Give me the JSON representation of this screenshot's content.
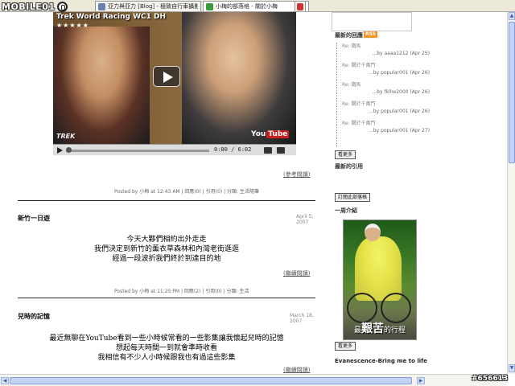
{
  "brand": {
    "wordmark": "MOBILE01",
    "icon": "mobile01-logo-icon"
  },
  "tabs": [
    {
      "label": "亞力與亞力 [Blog] - 極致自行車攝影部落格",
      "favicon_color": "#6b7fb3",
      "close": "x"
    },
    {
      "label": "小梅的部落格 - 關於小梅",
      "favicon_color": "#3a9a3a",
      "close": "x"
    },
    {
      "label": "",
      "favicon_color": "#cc3333",
      "close": ""
    }
  ],
  "video": {
    "title": "Trek World Racing WC1 DH",
    "stars": "★★★★★",
    "brand_trek": "TREK",
    "brand_you": "You",
    "brand_tube": "Tube",
    "time": "0:00 / 6:02",
    "progress": 0.0
  },
  "post1": {
    "more": "(參考閱讀)",
    "meta": "Posted by 小梅 at 12:43 AM | 回應(0) | 引用(0) | 分類: 生活隨筆"
  },
  "post2": {
    "title": "新竹一日遊",
    "date": "April 5, 2007",
    "lines": [
      "今天大夥們相約出外走走",
      "我們決定到新竹的薰衣草森林和內灣老街逛逛",
      "經過一段波折我們終於到達目的地"
    ],
    "more": "(繼續閱讀)",
    "meta": "Posted by 小梅 at 11:25 PM | 回應(2) | 引用(0) | 分類: 生活"
  },
  "post3": {
    "title": "兒時的記憶",
    "date": "March 18, 2007",
    "lines": [
      "最近無聊在YouTube看到一些小時候常看的一些影集讓我懷起兒時的記憶",
      "想起每天時間一到就會準時收看",
      "我相信有不少人小時候跟我也有過這些影集"
    ],
    "more": "(繼續閱讀)"
  },
  "sidebar": {
    "trackback_title": "最新的回應",
    "rss": "RSS",
    "trackbacks": [
      {
        "head": "Re: 鐵馬",
        "by": "...by aaaa1212 (Apr 25)"
      },
      {
        "head": "Re: 關於千萬門",
        "by": "...by popular001 (Apr 26)"
      },
      {
        "head": "Re: 鐵馬",
        "by": "...by fklhe2000 (Apr 26)"
      },
      {
        "head": "Re: 關於千萬門",
        "by": "...by popular001 (Apr 26)"
      },
      {
        "head": "Re: 關於千萬門",
        "by": "...by popular001 (Apr 27)"
      }
    ],
    "btn_all": "看更多",
    "recent_tb_title": "最新的引用",
    "btn_subscribe": "訂閱此部落格",
    "featured_title": "一周介紹",
    "photo_caption_big": "艱苦",
    "photo_caption_prefix": "最",
    "photo_caption_suffix": "的行程",
    "btn_more": "看更多",
    "song": "Evanescence-Bring me to life"
  },
  "scrollbars": {
    "up": "▲",
    "down": "▼",
    "left": "◀",
    "right": "▶"
  },
  "watermark": "#656613"
}
